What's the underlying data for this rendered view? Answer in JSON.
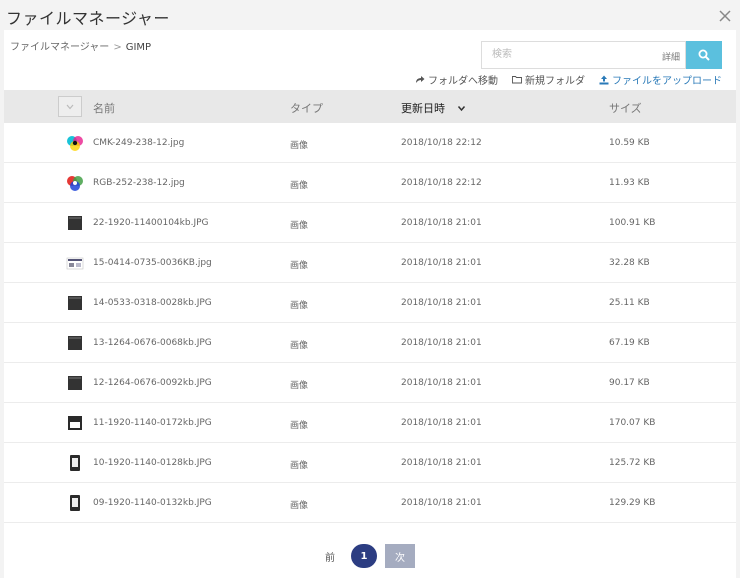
{
  "header": {
    "title": "ファイルマネージャー"
  },
  "breadcrumb": {
    "root": "ファイルマネージャー",
    "separator": ">",
    "current": "GIMP"
  },
  "search": {
    "placeholder": "検索",
    "detail_label": "詳細"
  },
  "actions": {
    "move_label": "フォルダへ移動",
    "new_folder_label": "新規フォルダ",
    "upload_label": "ファイルをアップロード"
  },
  "columns": {
    "name": "名前",
    "type": "タイプ",
    "modified": "更新日時",
    "size": "サイズ"
  },
  "files": [
    {
      "name": "CMK-249-238-12.jpg",
      "type": "画像",
      "modified": "2018/10/18 22:12",
      "size": "10.59 KB",
      "thumb": "cmy"
    },
    {
      "name": "RGB-252-238-12.jpg",
      "type": "画像",
      "modified": "2018/10/18 22:12",
      "size": "11.93 KB",
      "thumb": "rgb"
    },
    {
      "name": "22-1920-11400104kb.JPG",
      "type": "画像",
      "modified": "2018/10/18 21:01",
      "size": "100.91 KB",
      "thumb": "dark"
    },
    {
      "name": "15-0414-0735-0036KB.jpg",
      "type": "画像",
      "modified": "2018/10/18 21:01",
      "size": "32.28 KB",
      "thumb": "light"
    },
    {
      "name": "14-0533-0318-0028kb.JPG",
      "type": "画像",
      "modified": "2018/10/18 21:01",
      "size": "25.11 KB",
      "thumb": "dark"
    },
    {
      "name": "13-1264-0676-0068kb.JPG",
      "type": "画像",
      "modified": "2018/10/18 21:01",
      "size": "67.19 KB",
      "thumb": "dark"
    },
    {
      "name": "12-1264-0676-0092kb.JPG",
      "type": "画像",
      "modified": "2018/10/18 21:01",
      "size": "90.17 KB",
      "thumb": "dark"
    },
    {
      "name": "11-1920-1140-0172kb.JPG",
      "type": "画像",
      "modified": "2018/10/18 21:01",
      "size": "170.07 KB",
      "thumb": "window"
    },
    {
      "name": "10-1920-1140-0128kb.JPG",
      "type": "画像",
      "modified": "2018/10/18 21:01",
      "size": "125.72 KB",
      "thumb": "phone"
    },
    {
      "name": "09-1920-1140-0132kb.JPG",
      "type": "画像",
      "modified": "2018/10/18 21:01",
      "size": "129.29 KB",
      "thumb": "phone"
    }
  ],
  "pagination": {
    "prev_label": "前",
    "current_page": "1",
    "next_label": "次"
  }
}
